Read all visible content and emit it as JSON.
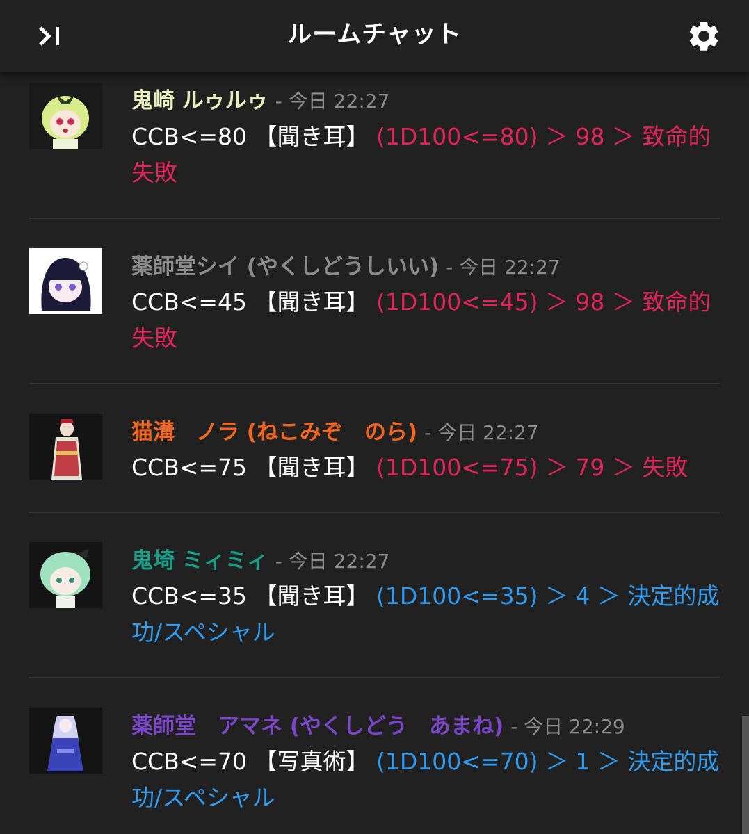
{
  "app": {
    "title": "ルームチャット",
    "collapse_icon": "panel-collapse-icon",
    "settings_icon": "gear-icon"
  },
  "colors": {
    "background": "#212121",
    "fail": "#e2245c",
    "success": "#2e9bf0",
    "meta": "#8c8c8c"
  },
  "messages": [
    {
      "name": "鬼崎 ルゥルゥ",
      "name_color": "#e8eebe",
      "meta": "- 今日 22:27",
      "command": "CCB<=80 【聞き耳】",
      "result": "(1D100<=80) ＞ 98 ＞ 致命的失敗",
      "outcome": "fail"
    },
    {
      "name": "薬師堂シイ (やくしどうしいい)",
      "name_color": "#8c8c8c",
      "meta": "- 今日 22:27",
      "command": "CCB<=45 【聞き耳】",
      "result": "(1D100<=45) ＞ 98 ＞ 致命的失敗",
      "outcome": "fail"
    },
    {
      "name": "猫溝　ノラ (ねこみぞ　のら)",
      "name_color": "#f4651f",
      "meta": "- 今日 22:27",
      "command": "CCB<=75 【聞き耳】",
      "result": "(1D100<=75) ＞ 79 ＞ 失敗",
      "outcome": "fail"
    },
    {
      "name": "鬼埼 ミィミィ",
      "name_color": "#199e8a",
      "meta": "- 今日 22:27",
      "command": "CCB<=35 【聞き耳】",
      "result": "(1D100<=35) ＞ 4 ＞ 決定的成功/スペシャル",
      "outcome": "success"
    },
    {
      "name": "薬師堂　アマネ (やくしどう　あまね)",
      "name_color": "#7b46c7",
      "meta": "- 今日 22:29",
      "command": "CCB<=70 【写真術】",
      "result": "(1D100<=70) ＞ 1 ＞ 決定的成功/スペシャル",
      "outcome": "success"
    }
  ]
}
